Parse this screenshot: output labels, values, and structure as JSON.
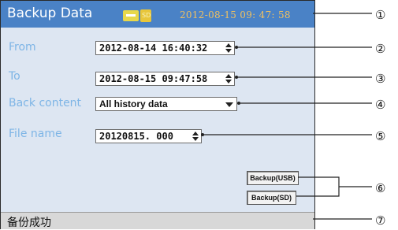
{
  "window": {
    "title": "Backup Data",
    "datetime": "2012-08-15 09: 47: 58",
    "sd_icon_text": "SD"
  },
  "form": {
    "from_label": "From",
    "from_value": "2012-08-14 16:40:32",
    "to_label": "To",
    "to_value": "2012-08-15 09:47:58",
    "back_content_label": "Back content",
    "back_content_value": "All history data",
    "file_name_label": "File name",
    "file_name_value": "20120815. 000"
  },
  "buttons": {
    "backup_usb": "Backup(USB)",
    "backup_sd": "Backup(SD)"
  },
  "status": {
    "text": "备份成功"
  },
  "callouts": {
    "c1": "①",
    "c2": "②",
    "c3": "③",
    "c4": "④",
    "c5": "⑤",
    "c6": "⑥",
    "c7": "⑦"
  },
  "colors": {
    "titlebar": "#4a82c6",
    "label": "#7eb5e6",
    "datetime": "#f0c060",
    "screen_bg": "#dde6f2"
  }
}
